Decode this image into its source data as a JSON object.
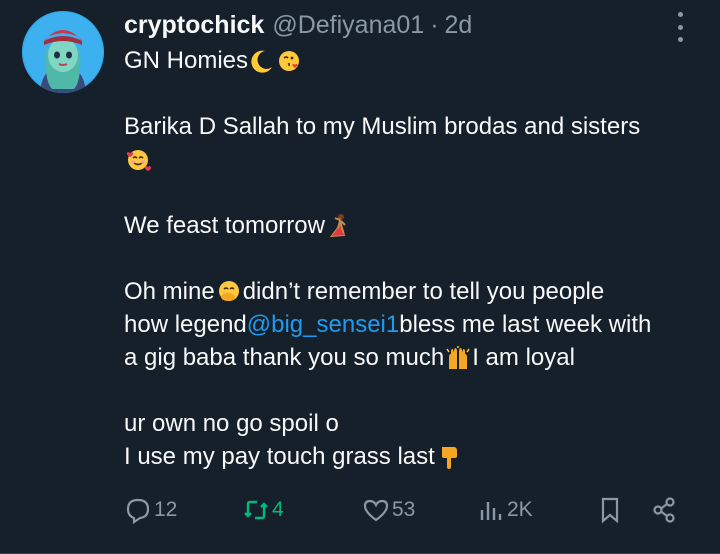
{
  "tweet": {
    "display_name": "cryptochick",
    "handle": "@Defiyana01",
    "separator": "·",
    "time": "2d",
    "avatar_icon": "cartoon-girl-avatar",
    "lines": {
      "l1": "GN Homies",
      "l2": "Barika D Sallah to my Muslim brodas and sisters",
      "l3": "We feast tomorrow",
      "l4a": "Oh mine",
      "l4b": " didn’t remember to tell you people",
      "l5a": "how legend ",
      "l5_mention": "@big_sensei1",
      "l5b": " bless me last week with",
      "l6a": "a gig baba thank you so much",
      "l6b": " I am loyal",
      "l7": "ur own no go spoil o",
      "l8": "I use my pay touch grass last"
    },
    "emojis": [
      "crescent-moon-icon",
      "face-blowing-kiss-icon",
      "smiling-face-with-hearts-icon",
      "dancer-icon",
      "face-with-hand-over-mouth-icon",
      "raising-hands-icon",
      "backhand-index-pointing-down-icon"
    ]
  },
  "actions": {
    "replies": "12",
    "reposts": "4",
    "likes": "53",
    "views": "2K"
  },
  "colors": {
    "background": "#15202b",
    "text": "#f7f9f9",
    "secondary": "#8b98a5",
    "link": "#1d9bf0",
    "repost_active": "#00ba7c"
  }
}
